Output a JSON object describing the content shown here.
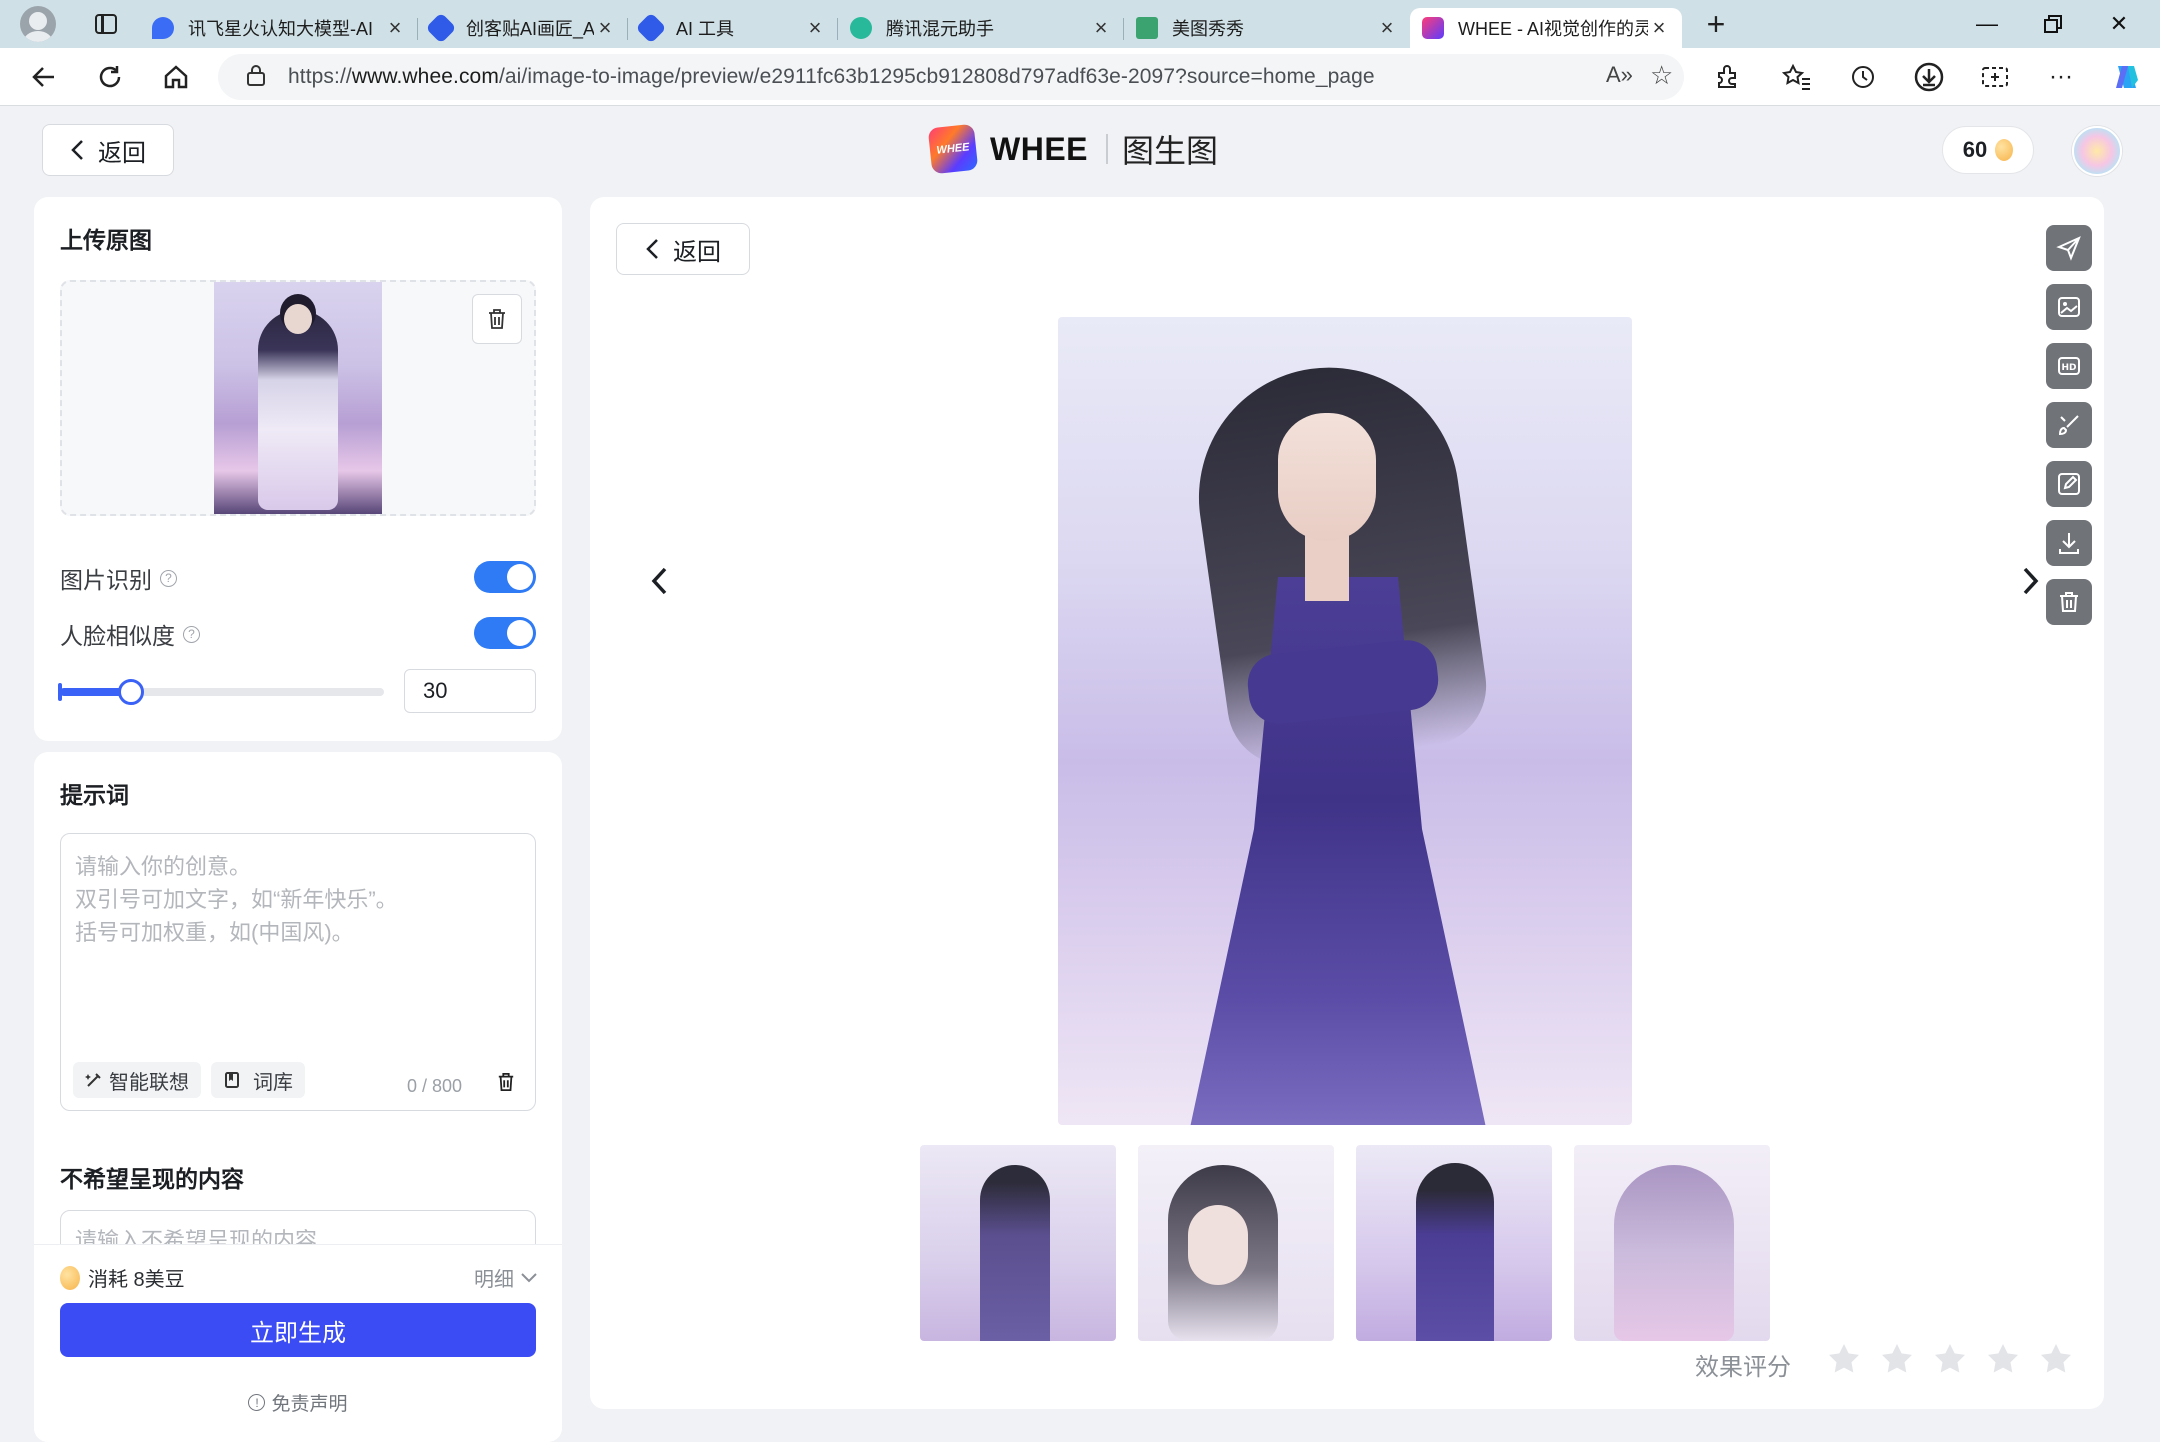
{
  "browser": {
    "tabs": [
      {
        "label": "讯飞星火认知大模型-AI",
        "favicon_color": "#3b6cf5"
      },
      {
        "label": "创客贴AI画匠_AI艺术创",
        "favicon_color": "#2f5be8"
      },
      {
        "label": "AI 工具",
        "favicon_color": "#2f5be8"
      },
      {
        "label": "腾讯混元助手",
        "favicon_color": "#28b99b"
      },
      {
        "label": "美图秀秀",
        "favicon_color": "#3aa36f"
      },
      {
        "label": "WHEE - AI视觉创作的灵",
        "favicon_color": "#5b3cff",
        "active": true
      }
    ],
    "url_prefix": "https://",
    "url_host": "www.whee.com",
    "url_path": "/ai/image-to-image/preview/e2911fc63b1295cb912808d797adf63e-2097?source=home_page"
  },
  "header": {
    "back_label": "返回",
    "brand_logo_text": "WHEE",
    "brand_name": "WHEE",
    "page_title": "图生图",
    "credits": "60"
  },
  "upload": {
    "title": "上传原图",
    "image_recognition_label": "图片识别",
    "image_recognition_on": true,
    "face_similarity_label": "人脸相似度",
    "face_similarity_on": true,
    "face_similarity_value": "30",
    "slider_fraction": 0.22
  },
  "prompt": {
    "title": "提示词",
    "placeholder_lines": [
      "请输入你的创意。",
      "双引号可加文字，如“新年快乐”。",
      "括号可加权重，如(中国风)。"
    ],
    "smart_label": "智能联想",
    "library_label": "词库",
    "counter": "0 / 800",
    "negative_title": "不希望呈现的内容",
    "negative_placeholder": "请输入不希望呈现的内容",
    "cost_label": "消耗 8美豆",
    "detail_label": "明细",
    "generate_label": "立即生成",
    "disclaimer_label": "免责声明"
  },
  "preview": {
    "back_label": "返回",
    "rating_label": "效果评分",
    "star_count": 5,
    "thumbnails": [
      "result-1",
      "result-2",
      "result-3",
      "result-4"
    ],
    "tools": [
      "send-icon",
      "image-edit-icon",
      "hd-icon",
      "brush-icon",
      "edit-icon",
      "download-icon",
      "delete-icon"
    ]
  }
}
